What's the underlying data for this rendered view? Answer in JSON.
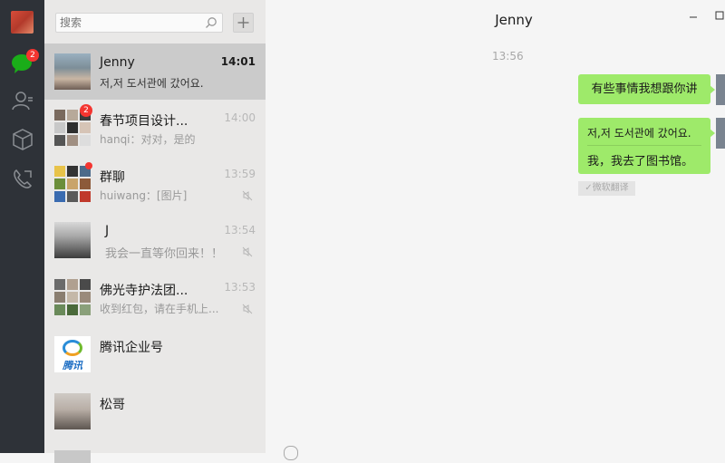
{
  "nav": {
    "chat_badge": "2",
    "icons": [
      "chat-icon",
      "contacts-icon",
      "favorites-icon",
      "phone-icon"
    ]
  },
  "search": {
    "placeholder": "搜索"
  },
  "add_button": "+",
  "conversations": [
    {
      "name": "Jenny",
      "preview": "저,저 도서관에 갔어요.",
      "time": "14:01",
      "active": true
    },
    {
      "name": "春节项目设计...",
      "preview": "hanqi：对对，是的",
      "time": "14:00",
      "badge": "2"
    },
    {
      "name": "群聊",
      "preview": "huiwang：[图片]",
      "time": "13:59"
    },
    {
      "name": "J",
      "preview": "我会一直等你回来！！",
      "time": "13:54"
    },
    {
      "name": "佛光寺护法团...",
      "preview": "收到红包，请在手机上...",
      "time": "13:53"
    },
    {
      "name": "腾讯企业号",
      "preview": "",
      "time": "",
      "logo_text": "腾讯"
    },
    {
      "name": "松哥",
      "preview": "",
      "time": ""
    }
  ],
  "chat": {
    "title": "Jenny",
    "timestamp": "13:56",
    "messages": [
      {
        "text": "有些事情我想跟你讲"
      },
      {
        "original": "저,저 도서관에 갔어요.",
        "translation": "我，我去了图书馆。",
        "translate_tag": "微软翻译"
      }
    ]
  },
  "colors": {
    "nav_bg": "#2e3238",
    "list_bg": "#e9e8e7",
    "active_row": "#cbcbcb",
    "bubble": "#9eea6a",
    "badge": "#f43530"
  }
}
